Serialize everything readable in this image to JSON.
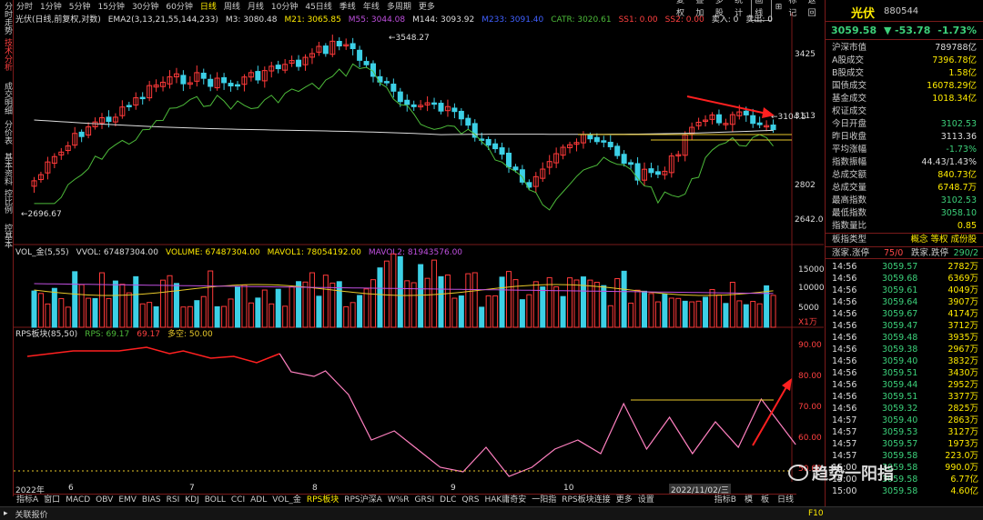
{
  "sidebar": [
    "分时走势",
    "技术分析",
    "成交明细",
    "分价表",
    "基本资料",
    "控比例",
    "控基本"
  ],
  "topbar": {
    "periods": [
      "分时",
      "1分钟",
      "5分钟",
      "15分钟",
      "30分钟",
      "60分钟",
      "日线",
      "周线",
      "月线",
      "10分钟",
      "45日线",
      "季线",
      "年线",
      "多周期",
      "更多"
    ],
    "active": "日线",
    "right_buttons": [
      "复权",
      "叠加",
      "多股",
      "统计",
      "画线",
      "标记",
      "返回"
    ],
    "boxed": "画线",
    "mark_icon": "plus-box-icon"
  },
  "legend1": {
    "name": "光伏(日线,前复权,对数)",
    "ema": "EMA2(3,13,21,55,144,233)",
    "m3": "M3: 3080.48",
    "m21": "M21: 3065.85",
    "m55": "M55: 3044.08",
    "m144": "M144: 3093.92",
    "m233": "M233: 3091.40",
    "catr": "CATR: 3020.61",
    "ss1": "SS1: 0.00",
    "ss2": "SS2: 0.00",
    "sell": "卖入: 0",
    "buy": "卖出: 0"
  },
  "legend2": {
    "name": "VOL_金(5,55)",
    "vvol": "VVOL: 67487304.00",
    "volume": "VOLUME: 67487304.00",
    "mavol1": "MAVOL1: 78054192.00",
    "mavol2": "MAVOL2: 81943576.00"
  },
  "legend3": {
    "name": "RPS板块(85,50)",
    "rps": "RPS: 69.17",
    "rps2": "69.17",
    "bull": "多空: 50.00"
  },
  "price_axis": [
    "3425",
    "3113",
    "2802",
    "2642.0"
  ],
  "vol_axis": [
    "15000",
    "10000",
    "5000",
    "X1万"
  ],
  "rps_axis": [
    "90.00",
    "80.00",
    "70.00",
    "60.00",
    "50.00"
  ],
  "annotations": {
    "high": "3548.27",
    "low": "2696.67",
    "last": "3104.5"
  },
  "x_labels": [
    "2022年",
    "6",
    "7",
    "8",
    "9",
    "10",
    "2022/11/02/三"
  ],
  "bottom_tabs": [
    "指标A",
    "窗口",
    "MACD",
    "OBV",
    "EMV",
    "BIAS",
    "RSI",
    "KDJ",
    "BOLL",
    "CCI",
    "ADL",
    "VOL_金",
    "RPS板块",
    "RPS沪深A",
    "W%R",
    "GRSI",
    "DLC",
    "QRS",
    "HAK庸奇安",
    "一阳指",
    "RPS板块连接",
    "更多",
    "设置"
  ],
  "bottom_active": "RPS板块",
  "bottom_right": [
    "指标B",
    "模",
    "板",
    "日线"
  ],
  "statusbar": {
    "text": "关联报价",
    "key": "F10"
  },
  "quote": {
    "name": "光伏",
    "code": "880544",
    "price": "3059.58",
    "change": "-53.78",
    "pct": "-1.73%",
    "stats": [
      {
        "k": "沪深市值",
        "v": "789788亿",
        "c": "w"
      },
      {
        "k": "A股成交",
        "v": "7396.78亿",
        "c": "y"
      },
      {
        "k": "B股成交",
        "v": "1.58亿",
        "c": "y"
      },
      {
        "k": "国债成交",
        "v": "16078.29亿",
        "c": "y"
      },
      {
        "k": "基金成交",
        "v": "1018.34亿",
        "c": "y"
      },
      {
        "k": "权证成交",
        "v": "",
        "c": "y"
      },
      {
        "k": "今日开盘",
        "v": "3102.53",
        "c": "g"
      },
      {
        "k": "昨日收盘",
        "v": "3113.36",
        "c": "w"
      },
      {
        "k": "平均涨幅",
        "v": "-1.73%",
        "c": "g"
      },
      {
        "k": "指数振幅",
        "v": "44.43/1.43%",
        "c": "w"
      },
      {
        "k": "总成交额",
        "v": "840.73亿",
        "c": "y"
      },
      {
        "k": "总成交量",
        "v": "6748.7万",
        "c": "y"
      },
      {
        "k": "最高指数",
        "v": "3102.53",
        "c": "g"
      },
      {
        "k": "最低指数",
        "v": "3058.10",
        "c": "g"
      },
      {
        "k": "指数量比",
        "v": "0.85",
        "c": "y"
      }
    ],
    "sector": {
      "k": "板指类型",
      "v": "概念 等权 成份股"
    },
    "updown": {
      "up_k": "涨家.涨停",
      "up_v": "75/0",
      "down_k": "跌家.跌停",
      "down_v": "290/2"
    },
    "ticks": [
      [
        "14:56",
        "3059.57",
        "2782万"
      ],
      [
        "14:56",
        "3059.68",
        "6369万"
      ],
      [
        "14:56",
        "3059.61",
        "4049万"
      ],
      [
        "14:56",
        "3059.64",
        "3907万"
      ],
      [
        "14:56",
        "3059.67",
        "4174万"
      ],
      [
        "14:56",
        "3059.47",
        "3712万"
      ],
      [
        "14:56",
        "3059.48",
        "3935万"
      ],
      [
        "14:56",
        "3059.38",
        "2967万"
      ],
      [
        "14:56",
        "3059.40",
        "3832万"
      ],
      [
        "14:56",
        "3059.51",
        "3430万"
      ],
      [
        "14:56",
        "3059.44",
        "2952万"
      ],
      [
        "14:56",
        "3059.51",
        "3377万"
      ],
      [
        "14:56",
        "3059.32",
        "2825万"
      ],
      [
        "14:57",
        "3059.40",
        "2863万"
      ],
      [
        "14:57",
        "3059.53",
        "3127万"
      ],
      [
        "14:57",
        "3059.57",
        "1973万"
      ],
      [
        "14:57",
        "3059.58",
        "223.0万"
      ],
      [
        "15:00",
        "3059.58",
        "990.0万"
      ],
      [
        "15:00",
        "3059.58",
        "6.77亿"
      ],
      [
        "15:00",
        "3059.58",
        "4.60亿"
      ]
    ]
  },
  "watermark": "趋势一阳指",
  "colors": {
    "up": "#ff3a3a",
    "down": "#3cd0e6",
    "ma_green": "#4dbb3a",
    "ma_white": "#dddddd",
    "ma_yellow": "#e8c92a",
    "ma_purple": "#c050e0"
  }
}
